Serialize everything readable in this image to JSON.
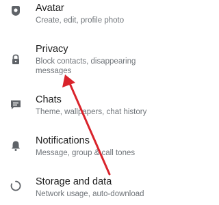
{
  "settings": {
    "items": [
      {
        "title": "Avatar",
        "subtitle": "Create, edit, profile photo",
        "icon": "avatar-icon"
      },
      {
        "title": "Privacy",
        "subtitle": "Block contacts, disappearing messages",
        "icon": "lock-icon"
      },
      {
        "title": "Chats",
        "subtitle": "Theme, wallpapers, chat history",
        "icon": "chat-icon"
      },
      {
        "title": "Notifications",
        "subtitle": "Message, group & call tones",
        "icon": "bell-icon"
      },
      {
        "title": "Storage and data",
        "subtitle": "Network usage, auto-download",
        "icon": "storage-icon"
      }
    ]
  },
  "annotation": {
    "arrow_color": "#d9232b",
    "points_to": "Privacy"
  },
  "colors": {
    "icon": "#5f6368",
    "title": "#1c1c1c",
    "subtitle": "#6f7479"
  }
}
